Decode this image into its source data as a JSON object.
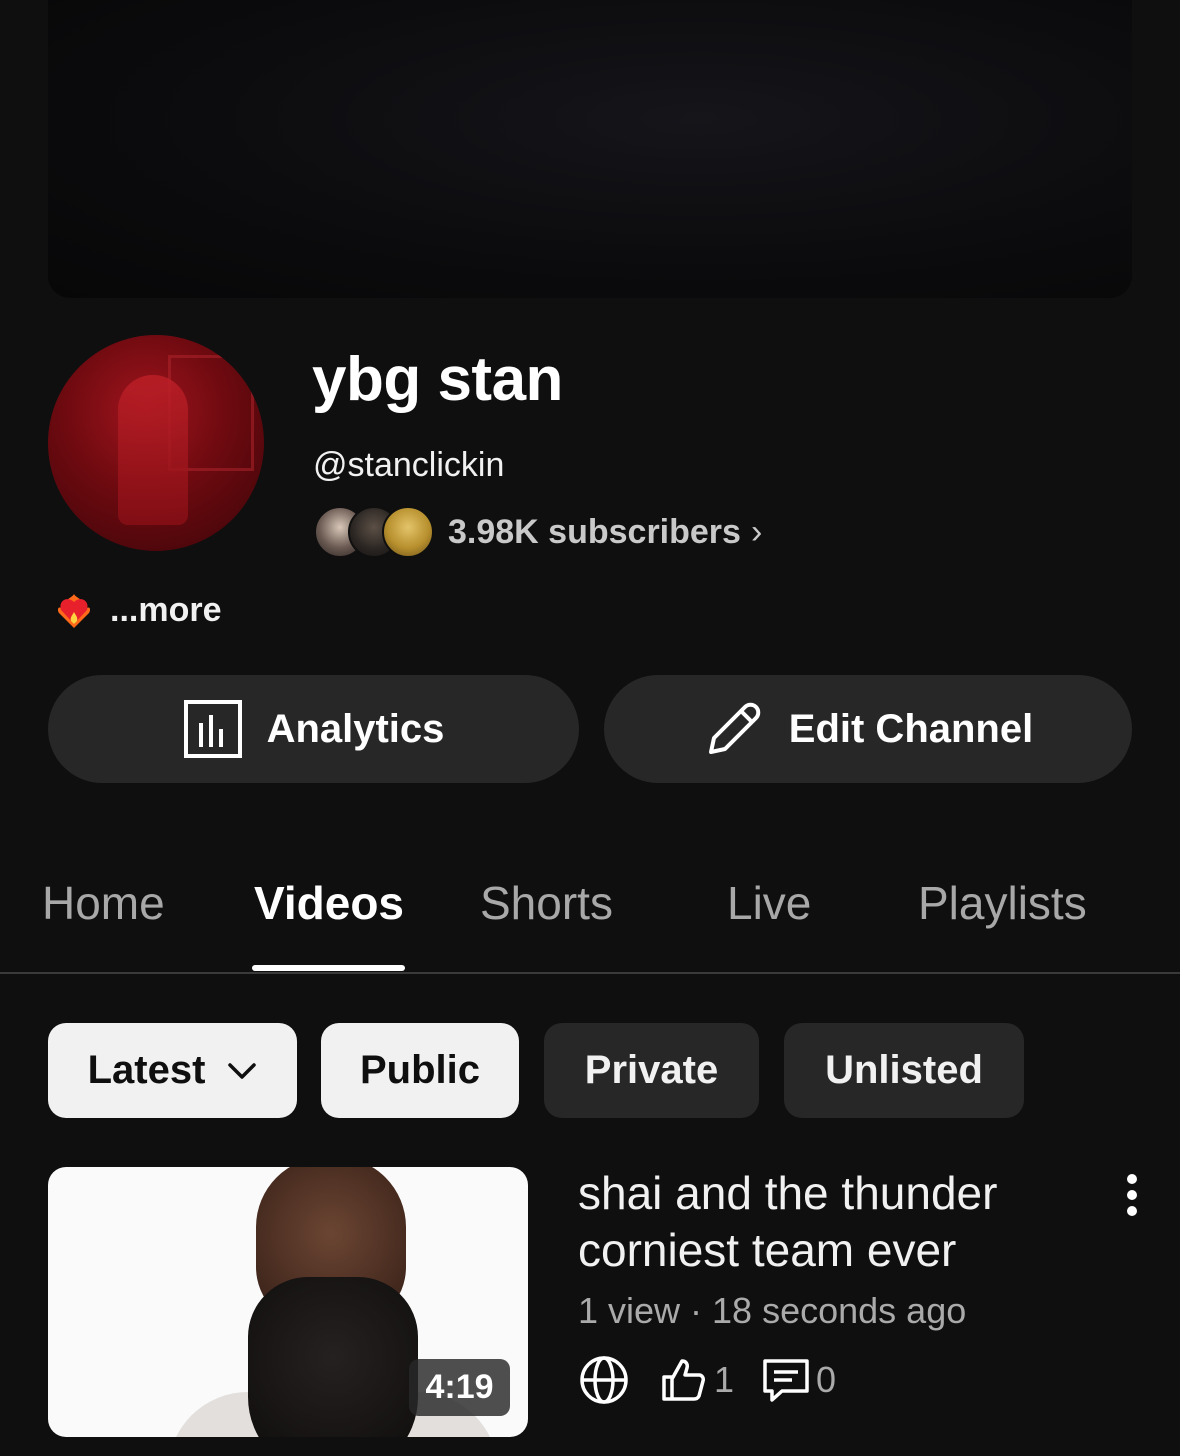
{
  "channel": {
    "name": "ybg stan",
    "handle": "@stanclickin",
    "subscribers": "3.98K subscribers",
    "description_more": "...more"
  },
  "actions": {
    "analytics_label": "Analytics",
    "edit_label": "Edit Channel"
  },
  "tabs": [
    {
      "label": "Home"
    },
    {
      "label": "Videos",
      "active": true
    },
    {
      "label": "Shorts"
    },
    {
      "label": "Live"
    },
    {
      "label": "Playlists"
    }
  ],
  "filters": {
    "sort": "Latest",
    "chips": [
      "Public",
      "Private",
      "Unlisted"
    ]
  },
  "video": {
    "title": "shai and the thunder corniest team ever",
    "meta": "1 view · 18 seconds ago",
    "duration": "4:19",
    "likes": "1",
    "comments": "0"
  },
  "colors": {
    "background": "#0f0f0f",
    "button_dark": "#272727",
    "chip_light": "#f1f1f1"
  }
}
